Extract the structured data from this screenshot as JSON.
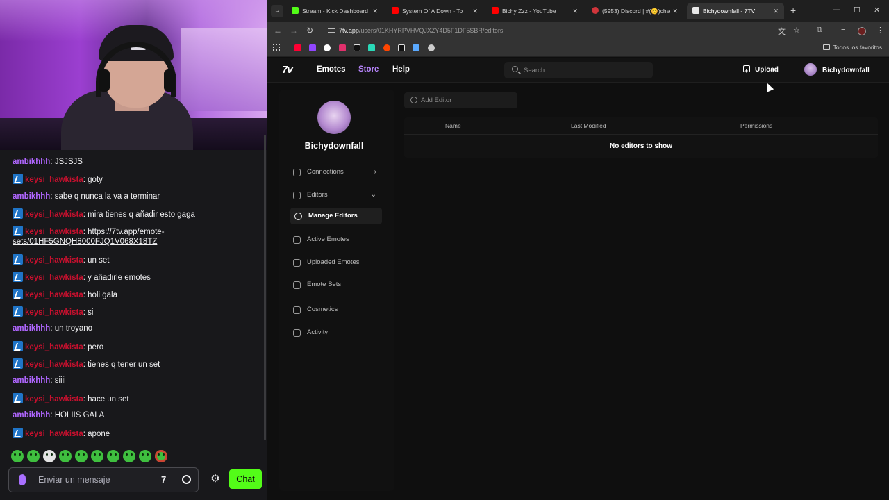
{
  "chat": {
    "messages": [
      {
        "user": "ambikhhh",
        "kind": "amb",
        "badge": false,
        "text": "JSJSJS"
      },
      {
        "user": "keysi_hawkista",
        "kind": "key",
        "badge": true,
        "text": "goty"
      },
      {
        "user": "ambikhhh",
        "kind": "amb",
        "badge": false,
        "text": "sabe q nunca la va a terminar"
      },
      {
        "user": "keysi_hawkista",
        "kind": "key",
        "badge": true,
        "text": "mira tienes q añadir esto gaga"
      },
      {
        "user": "keysi_hawkista",
        "kind": "key",
        "badge": true,
        "link1": "https://7tv.app/emote-",
        "link2": "sets/01HF5GNQH8000FJQ1V068X18TZ"
      },
      {
        "user": "keysi_hawkista",
        "kind": "key",
        "badge": true,
        "text": "un set"
      },
      {
        "user": "keysi_hawkista",
        "kind": "key",
        "badge": true,
        "text": "y añadirle emotes"
      },
      {
        "user": "keysi_hawkista",
        "kind": "key",
        "badge": true,
        "text": "holi gala"
      },
      {
        "user": "keysi_hawkista",
        "kind": "key",
        "badge": true,
        "text": "si"
      },
      {
        "user": "ambikhhh",
        "kind": "amb",
        "badge": false,
        "text": "un troyano"
      },
      {
        "user": "keysi_hawkista",
        "kind": "key",
        "badge": true,
        "text": "pero"
      },
      {
        "user": "keysi_hawkista",
        "kind": "key",
        "badge": true,
        "text": "tienes q tener un set"
      },
      {
        "user": "ambikhhh",
        "kind": "amb",
        "badge": false,
        "text": "siiii"
      },
      {
        "user": "keysi_hawkista",
        "kind": "key",
        "badge": true,
        "text": "hace un set"
      },
      {
        "user": "ambikhhh",
        "kind": "amb",
        "badge": false,
        "text": "HOLIIS GALA"
      },
      {
        "user": "keysi_hawkista",
        "kind": "key",
        "badge": true,
        "text": "apone"
      }
    ],
    "input_placeholder": "Enviar un mensaje",
    "chat_button": "Chat",
    "seven_icon": "7"
  },
  "browser": {
    "tabs": [
      {
        "title": "Stream - Kick Dashboard",
        "favicon_color": "#53fc18"
      },
      {
        "title": "System Of A Down - To",
        "favicon_color": "#ff0000"
      },
      {
        "title": "Bichy Zzz - YouTube",
        "favicon_color": "#ff0000"
      },
      {
        "title": "(5953) Discord | #(😊)che",
        "favicon_color": "#d0353b"
      },
      {
        "title": "Bichydownfall - 7TV",
        "favicon_color": "#ffffff"
      }
    ],
    "url_host": "7tv.app",
    "url_path": "/users/01KHYRPVHVQJXZY4D5F1DF5SBR/editors",
    "bookmarks_label": "Todos los favoritos",
    "bookmark_colors": [
      "#ff0033",
      "#9146ff",
      "#e1306c",
      "#ffffff",
      "#ffffff",
      "#2ad9b8",
      "#ff4500",
      "#ffffff",
      "#5aa9ff",
      "#cccccc"
    ]
  },
  "seventv": {
    "logo": "7v",
    "nav": [
      {
        "label": "Emotes",
        "color": "#ffffff"
      },
      {
        "label": "Store",
        "color": "#b986ff"
      },
      {
        "label": "Help",
        "color": "#ffffff"
      }
    ],
    "search_placeholder": "Search",
    "upload_label": "Upload",
    "username": "Bichydownfall",
    "sidebar": {
      "profile_name": "Bichydownfall",
      "items": [
        {
          "label": "Connections",
          "chevron": "›"
        },
        {
          "label": "Editors",
          "chevron": "⌄"
        },
        {
          "label": "Manage Editors",
          "chevron": ""
        },
        {
          "label": "Active Emotes",
          "chevron": ""
        },
        {
          "label": "Uploaded Emotes",
          "chevron": ""
        },
        {
          "label": "Emote Sets",
          "chevron": ""
        },
        {
          "label": "Cosmetics",
          "chevron": ""
        },
        {
          "label": "Activity",
          "chevron": ""
        }
      ]
    },
    "editors": {
      "add_placeholder": "Add Editor",
      "columns": [
        "Name",
        "Last Modified",
        "Permissions"
      ],
      "empty_text": "No editors to show"
    }
  }
}
